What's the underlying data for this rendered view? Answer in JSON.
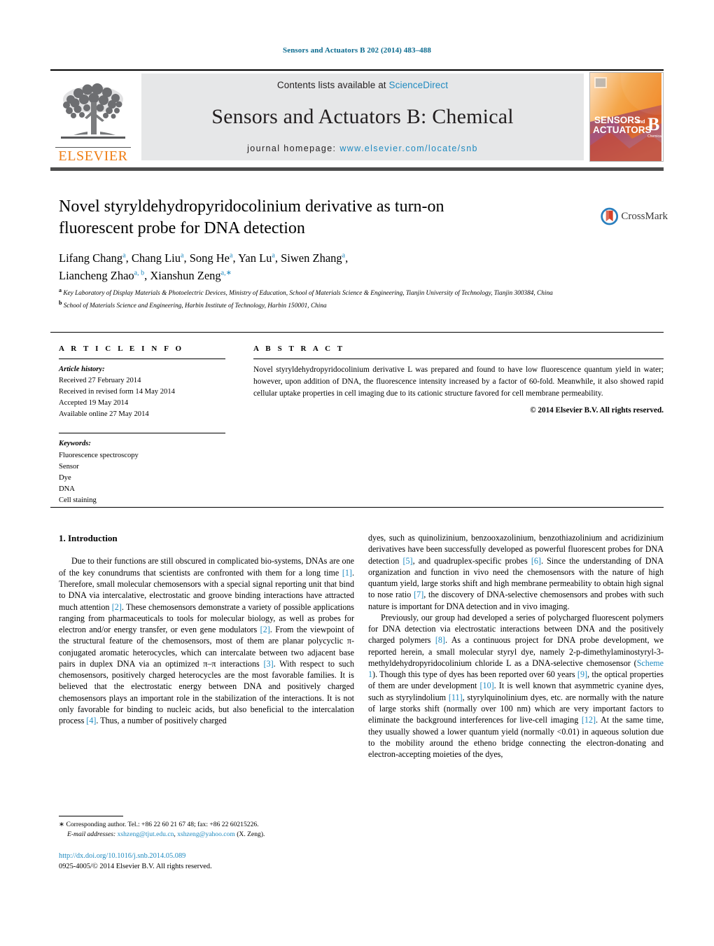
{
  "running_head": "Sensors and Actuators B 202 (2014) 483–488",
  "masthead": {
    "publisher_logo_label": "ELSEVIER",
    "contents_prefix": "Contents lists available at ",
    "contents_link": "ScienceDirect",
    "journal_title": "Sensors and Actuators B: Chemical",
    "homepage_prefix": "journal homepage: ",
    "homepage_url": "www.elsevier.com/locate/snb",
    "cover": {
      "line1": "SENSORS",
      "line1_small": "and",
      "line2": "ACTUATORS",
      "letter": "B",
      "letter_sub": "Chemical"
    }
  },
  "crossmark": {
    "label": "CrossMark"
  },
  "article": {
    "title": "Novel styryldehydropyridocolinium derivative as turn-on fluorescent probe for DNA detection",
    "authors_line1": "Lifang Chang",
    "authors": [
      {
        "name": "Lifang Chang",
        "sup": "a",
        "sep": ", "
      },
      {
        "name": "Chang Liu",
        "sup": "a",
        "sep": ", "
      },
      {
        "name": "Song He",
        "sup": "a",
        "sep": ", "
      },
      {
        "name": "Yan Lu",
        "sup": "a",
        "sep": ", "
      },
      {
        "name": "Siwen Zhang",
        "sup": "a",
        "sep": ","
      },
      {
        "name": "Liancheng Zhao",
        "sup": "a, b",
        "sep": ", "
      },
      {
        "name": "Xianshun Zeng",
        "sup": "a,∗",
        "sep": ""
      }
    ],
    "affiliations": [
      {
        "marker": "a",
        "text": "Key Laboratory of Display Materials & Photoelectric Devices, Ministry of Education, School of Materials Science & Engineering, Tianjin University of Technology, Tianjin 300384, China"
      },
      {
        "marker": "b",
        "text": "School of Materials Science and Engineering, Harbin Institute of Technology, Harbin 150001, China"
      }
    ]
  },
  "article_info": {
    "heading": "A R T I C L E   I N F O",
    "history_label": "Article history:",
    "history": [
      "Received 27 February 2014",
      "Received in revised form 14 May 2014",
      "Accepted 19 May 2014",
      "Available online 27 May 2014"
    ],
    "keywords_label": "Keywords:",
    "keywords": [
      "Fluorescence spectroscopy",
      "Sensor",
      "Dye",
      "DNA",
      "Cell staining"
    ]
  },
  "abstract": {
    "heading": "A B S T R A C T",
    "text": "Novel styryldehydropyridocolinium derivative L was prepared and found to have low fluorescence quantum yield in water; however, upon addition of DNA, the fluorescence intensity increased by a factor of 60-fold. Meanwhile, it also showed rapid cellular uptake properties in cell imaging due to its cationic structure favored for cell membrane permeability.",
    "copyright": "© 2014 Elsevier B.V. All rights reserved."
  },
  "body": {
    "section_heading": "1.  Introduction",
    "left_paragraph_1_a": "Due to their functions are still obscured in complicated bio-systems, DNAs are one of the key conundrums that scientists are confronted with them for a long time ",
    "left_ref_1": "[1]",
    "left_paragraph_1_b": ". Therefore, small molecular chemosensors with a special signal reporting unit that bind to DNA via intercalative, electrostatic and groove binding interactions have attracted much attention ",
    "left_ref_2": "[2]",
    "left_paragraph_1_c": ". These chemosensors demonstrate a variety of possible applications ranging from pharmaceuticals to tools for molecular biology, as well as probes for electron and/or energy transfer, or even gene modulators ",
    "left_ref_3": "[2]",
    "left_paragraph_1_d": ". From the viewpoint of the structural feature of the chemosensors, most of them are planar polycyclic π-conjugated aromatic heterocycles, which can intercalate between two adjacent base pairs in duplex DNA via an optimized π–π interactions ",
    "left_ref_4": "[3]",
    "left_paragraph_1_e": ". With respect to such chemosensors, positively charged heterocycles are the most favorable families. It is believed that the electrostatic energy between DNA and positively charged chemosensors plays an important role in the stabilization of the interactions. It is not only favorable for binding to nucleic acids, but also beneficial to the intercalation process ",
    "left_ref_5": "[4]",
    "left_paragraph_1_f": ". Thus, a number of positively charged",
    "right_paragraph_1_a": "dyes, such as quinolizinium, benzooxazolinium, benzothiazolinium and acridizinium derivatives have been successfully developed as powerful fluorescent probes for DNA detection ",
    "right_ref_5": "[5]",
    "right_paragraph_1_b": ", and quadruplex-specific probes ",
    "right_ref_6": "[6]",
    "right_paragraph_1_c": ". Since the understanding of DNA organization and function in vivo need the chemosensors with the nature of high quantum yield, large storks shift and high membrane permeability to obtain high signal to nose ratio ",
    "right_ref_7": "[7]",
    "right_paragraph_1_d": ", the discovery of DNA-selective chemosensors and probes with such nature is important for DNA detection and in vivo imaging.",
    "right_paragraph_2_a": "Previously, our group had developed a series of polycharged fluorescent polymers for DNA detection via electrostatic interactions between DNA and the positively charged polymers ",
    "right_ref_8": "[8]",
    "right_paragraph_2_b": ". As a continuous project for DNA probe development, we reported herein, a small molecular styryl dye, namely 2-p-dimethylaminostyryl-3-methyldehydropyridocolinium chloride L as a DNA-selective chemosensor (",
    "right_scheme_link": "Scheme 1",
    "right_paragraph_2_c": "). Though this type of dyes has been reported over 60 years ",
    "right_ref_9": "[9]",
    "right_paragraph_2_d": ", the optical properties of them are under development ",
    "right_ref_10": "[10]",
    "right_paragraph_2_e": ". It is well known that asymmetric cyanine dyes, such as styrylindolium ",
    "right_ref_11": "[11]",
    "right_paragraph_2_f": ", styrylquinolinium dyes, etc. are normally with the nature of large storks shift (normally over 100 nm) which are very important factors to eliminate the background interferences for live-cell imaging ",
    "right_ref_12": "[12]",
    "right_paragraph_2_g": ". At the same time, they usually showed a lower quantum yield (normally <0.01) in aqueous solution due to the mobility around the etheno bridge connecting the electron-donating and electron-accepting moieties of the dyes,"
  },
  "footer": {
    "corresponding_marker": "∗",
    "corresponding_text": "Corresponding author. Tel.: +86 22 60 21 67 48; fax: +86 22 60215226.",
    "email_label": "E-mail addresses:",
    "email_1": "xshzeng@tjut.edu.cn",
    "email_sep": ", ",
    "email_2": "xshzeng@yahoo.com",
    "email_suffix": " (X. Zeng).",
    "doi_url": "http://dx.doi.org/10.1016/j.snb.2014.05.089",
    "issn_line": "0925-4005/© 2014 Elsevier B.V. All rights reserved."
  },
  "colors": {
    "link": "#1f8ac0",
    "elsevier_orange": "#ef7d14",
    "band_gray": "#e6e7e8"
  }
}
